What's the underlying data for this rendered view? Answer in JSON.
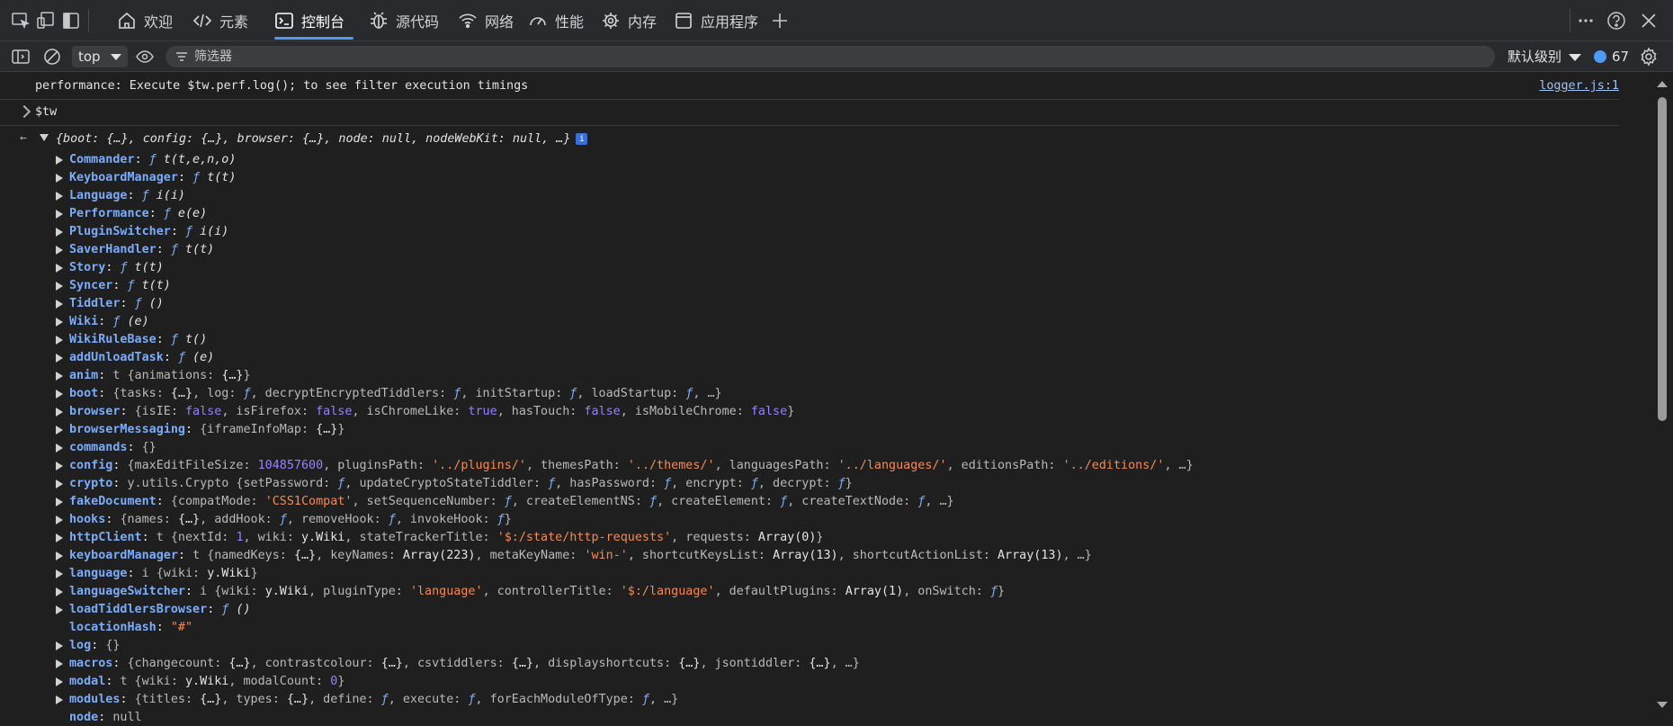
{
  "tabs": [
    {
      "label": "欢迎",
      "icon": "home-icon"
    },
    {
      "label": "元素",
      "icon": "code-icon"
    },
    {
      "label": "控制台",
      "icon": "console-icon",
      "active": true
    },
    {
      "label": "源代码",
      "icon": "bug-icon"
    },
    {
      "label": "网络",
      "icon": "wifi-icon"
    },
    {
      "label": "性能",
      "icon": "gauge-icon"
    },
    {
      "label": "内存",
      "icon": "gear-chip-icon"
    },
    {
      "label": "应用程序",
      "icon": "window-icon"
    }
  ],
  "toolbar": {
    "context": "top",
    "filter_placeholder": "筛选器",
    "levels": "默认级别",
    "issues_count": "67"
  },
  "console": {
    "log_message": "performance: Execute $tw.perf.log(); to see filter execution timings",
    "log_source": "logger.js:1",
    "input_command": "$tw",
    "summary": "{boot: {…}, config: {…}, browser: {…}, node: null, nodeWebKit: null, …}",
    "info_badge": "i"
  },
  "accent": "#4e9bf5"
}
